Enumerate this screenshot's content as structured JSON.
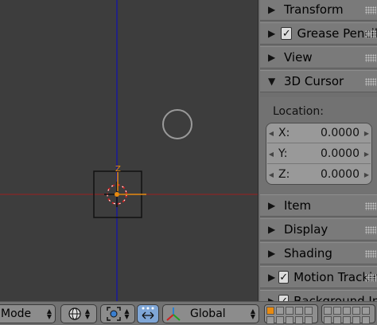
{
  "viewport": {
    "colors": {
      "bg": "#3d3d3d",
      "x_axis": "#9a2020",
      "y_axis": "#1a1a9a",
      "selection": "#e88a10"
    },
    "gizmo_label": "Z"
  },
  "panel": {
    "sections": [
      {
        "label": "Transform",
        "expanded": false,
        "checkbox": false
      },
      {
        "label": "Grease Pencil",
        "expanded": false,
        "checkbox": true
      },
      {
        "label": "View",
        "expanded": false,
        "checkbox": false
      },
      {
        "label": "3D Cursor",
        "expanded": true,
        "checkbox": false
      },
      {
        "label": "Item",
        "expanded": false,
        "checkbox": false
      },
      {
        "label": "Display",
        "expanded": false,
        "checkbox": false
      },
      {
        "label": "Shading",
        "expanded": false,
        "checkbox": false
      },
      {
        "label": "Motion Tracking",
        "expanded": false,
        "checkbox": true
      },
      {
        "label": "Background Images",
        "expanded": false,
        "checkbox": true
      }
    ],
    "cursor": {
      "location_label": "Location:",
      "fields": [
        {
          "label": "X:",
          "value": "0.0000"
        },
        {
          "label": "Y:",
          "value": "0.0000"
        },
        {
          "label": "Z:",
          "value": "0.0000"
        }
      ]
    }
  },
  "header": {
    "mode_label": "Mode",
    "orientation_label": "Global"
  }
}
